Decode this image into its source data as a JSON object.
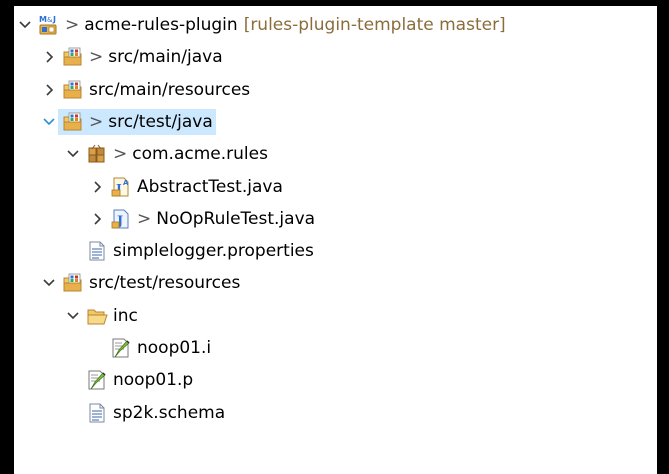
{
  "colors": {
    "selection": "#cce8ff",
    "decoration_text": "#8a6d3b",
    "chevron": "#3c3c3c",
    "folder": "#e8b04b",
    "package": "#c08a3e",
    "java_blue": "#2f6fd6"
  },
  "tree": [
    {
      "level": 0,
      "expand": "expanded",
      "icon": "project-icon",
      "dirty": ">",
      "label": "acme-rules-plugin",
      "decoration": "[rules-plugin-template master]",
      "selected": false
    },
    {
      "level": 1,
      "expand": "collapsed",
      "icon": "source-folder-icon",
      "dirty": ">",
      "label": "src/main/java",
      "decoration": "",
      "selected": false
    },
    {
      "level": 1,
      "expand": "collapsed",
      "icon": "source-folder-icon",
      "dirty": "",
      "label": "src/main/resources",
      "decoration": "",
      "selected": false
    },
    {
      "level": 1,
      "expand": "expanded",
      "icon": "source-folder-icon",
      "dirty": ">",
      "label": "src/test/java",
      "decoration": "",
      "selected": true
    },
    {
      "level": 2,
      "expand": "expanded",
      "icon": "package-icon",
      "dirty": ">",
      "label": "com.acme.rules",
      "decoration": "",
      "selected": false
    },
    {
      "level": 3,
      "expand": "collapsed",
      "icon": "abstract-java-class-icon",
      "dirty": "",
      "label": "AbstractTest.java",
      "decoration": "",
      "selected": false
    },
    {
      "level": 3,
      "expand": "collapsed",
      "icon": "java-file-icon",
      "dirty": ">",
      "label": "NoOpRuleTest.java",
      "decoration": "",
      "selected": false
    },
    {
      "level": 2,
      "expand": "none",
      "icon": "properties-file-icon",
      "dirty": "",
      "label": "simplelogger.properties",
      "decoration": "",
      "selected": false
    },
    {
      "level": 1,
      "expand": "expanded",
      "icon": "source-folder-icon",
      "dirty": "",
      "label": "src/test/resources",
      "decoration": "",
      "selected": false
    },
    {
      "level": 2,
      "expand": "expanded",
      "icon": "open-folder-icon",
      "dirty": "",
      "label": "inc",
      "decoration": "",
      "selected": false
    },
    {
      "level": 3,
      "expand": "none",
      "icon": "edit-file-icon",
      "dirty": "",
      "label": "noop01.i",
      "decoration": "",
      "selected": false
    },
    {
      "level": 2,
      "expand": "none",
      "icon": "edit-file-icon",
      "dirty": "",
      "label": "noop01.p",
      "decoration": "",
      "selected": false
    },
    {
      "level": 2,
      "expand": "none",
      "icon": "properties-file-icon",
      "dirty": "",
      "label": "sp2k.schema",
      "decoration": "",
      "selected": false
    }
  ]
}
